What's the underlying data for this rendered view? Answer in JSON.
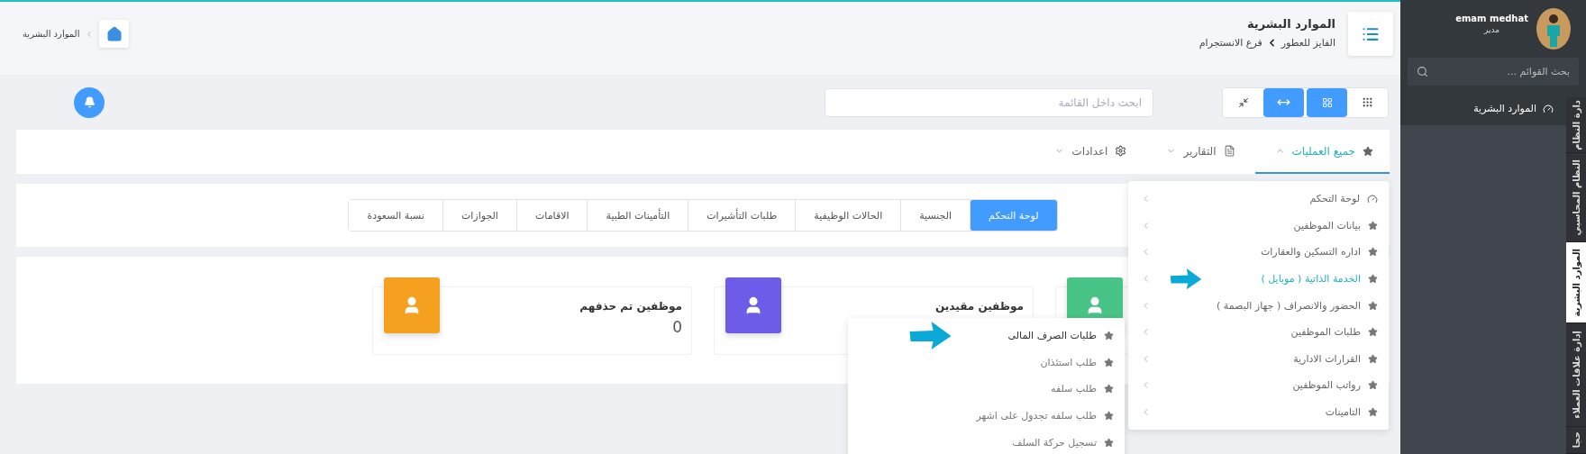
{
  "header": {
    "title": "الموارد البشرية",
    "breadcrumb": [
      "الفايز للعطور",
      "فرع الانستجرام"
    ],
    "home_breadcrumb": "الموارد البشرية"
  },
  "toolbar": {
    "search": {
      "placeholder": "ابحث داخل القائمة"
    },
    "view_buttons": [
      {
        "kind": "dots",
        "selected": false
      },
      {
        "kind": "grid",
        "selected": true
      },
      {
        "kind": "expand",
        "selected": true
      },
      {
        "kind": "compress",
        "selected": false
      }
    ]
  },
  "nav_tabs": [
    {
      "label": "جميع العمليات",
      "kind": "star",
      "selected": true,
      "expanded": true
    },
    {
      "label": "التقارير",
      "kind": "file",
      "selected": false,
      "expanded": false
    },
    {
      "label": "اعدادات",
      "kind": "gear",
      "selected": false,
      "expanded": false
    }
  ],
  "operations_menu": [
    {
      "label": "لوحة التحكم",
      "kind": "gauge",
      "selected": false,
      "pointer": false
    },
    {
      "label": "بيانات الموظفين",
      "kind": "star",
      "selected": false,
      "pointer": false
    },
    {
      "label": "اداره التسكين والعقارات",
      "kind": "star",
      "selected": false,
      "pointer": false
    },
    {
      "label": "الخدمة الذاتية ( موبايل )",
      "kind": "star",
      "selected": true,
      "pointer": true
    },
    {
      "label": "الحضور والانصراف ( جهاز البصمة )",
      "kind": "star",
      "selected": false,
      "pointer": false
    },
    {
      "label": "طلبات الموظفين",
      "kind": "star",
      "selected": false,
      "pointer": false
    },
    {
      "label": "القرارات الادارية",
      "kind": "star",
      "selected": false,
      "pointer": false
    },
    {
      "label": "رواتب الموظفين",
      "kind": "star",
      "selected": false,
      "pointer": false
    },
    {
      "label": "التامينات",
      "kind": "star",
      "selected": false,
      "pointer": false
    }
  ],
  "submenu": [
    {
      "label": "طلبات الصرف المالى",
      "selected": true,
      "pointer": true
    },
    {
      "label": "طلب استئذان",
      "selected": false,
      "pointer": false
    },
    {
      "label": "طلب سلفه",
      "selected": false,
      "pointer": false
    },
    {
      "label": "طلب سلفه تجدول على اشهر",
      "selected": false,
      "pointer": false
    },
    {
      "label": "تسجيل حركة السلف",
      "selected": false,
      "pointer": false
    }
  ],
  "pill_tabs": [
    {
      "label": "لوحة التحكم",
      "selected": true
    },
    {
      "label": "الجنسية",
      "selected": false
    },
    {
      "label": "الحالات الوظيفية",
      "selected": false
    },
    {
      "label": "طلبات التأشيرات",
      "selected": false
    },
    {
      "label": "التأمينات الطبية",
      "selected": false
    },
    {
      "label": "الاقامات",
      "selected": false
    },
    {
      "label": "الجوازات",
      "selected": false
    },
    {
      "label": "نسبة السعودة",
      "selected": false
    }
  ],
  "stat_cards": [
    {
      "color": "#48c486"
    },
    {
      "title": "موظفين مقيدين",
      "color": "#6c5ce7"
    },
    {
      "title": "موظفين تم حذفهم",
      "value": "0",
      "color": "#f5a01f"
    }
  ],
  "sidebar": {
    "user": {
      "name": "emam medhat",
      "role": "مدير"
    },
    "search": {
      "placeholder": "بحث القوائم ..."
    },
    "items": [
      {
        "label": "الموارد البشرية"
      }
    ],
    "vertical_tabs": [
      {
        "label": "دارة النظام",
        "selected": false
      },
      {
        "label": "النظام المحاسبي",
        "selected": false
      },
      {
        "label": "الموارد البشرية",
        "selected": true
      },
      {
        "label": "إدارة علاقات العملاء",
        "selected": false
      },
      {
        "label": "حجا",
        "selected": false
      }
    ]
  }
}
